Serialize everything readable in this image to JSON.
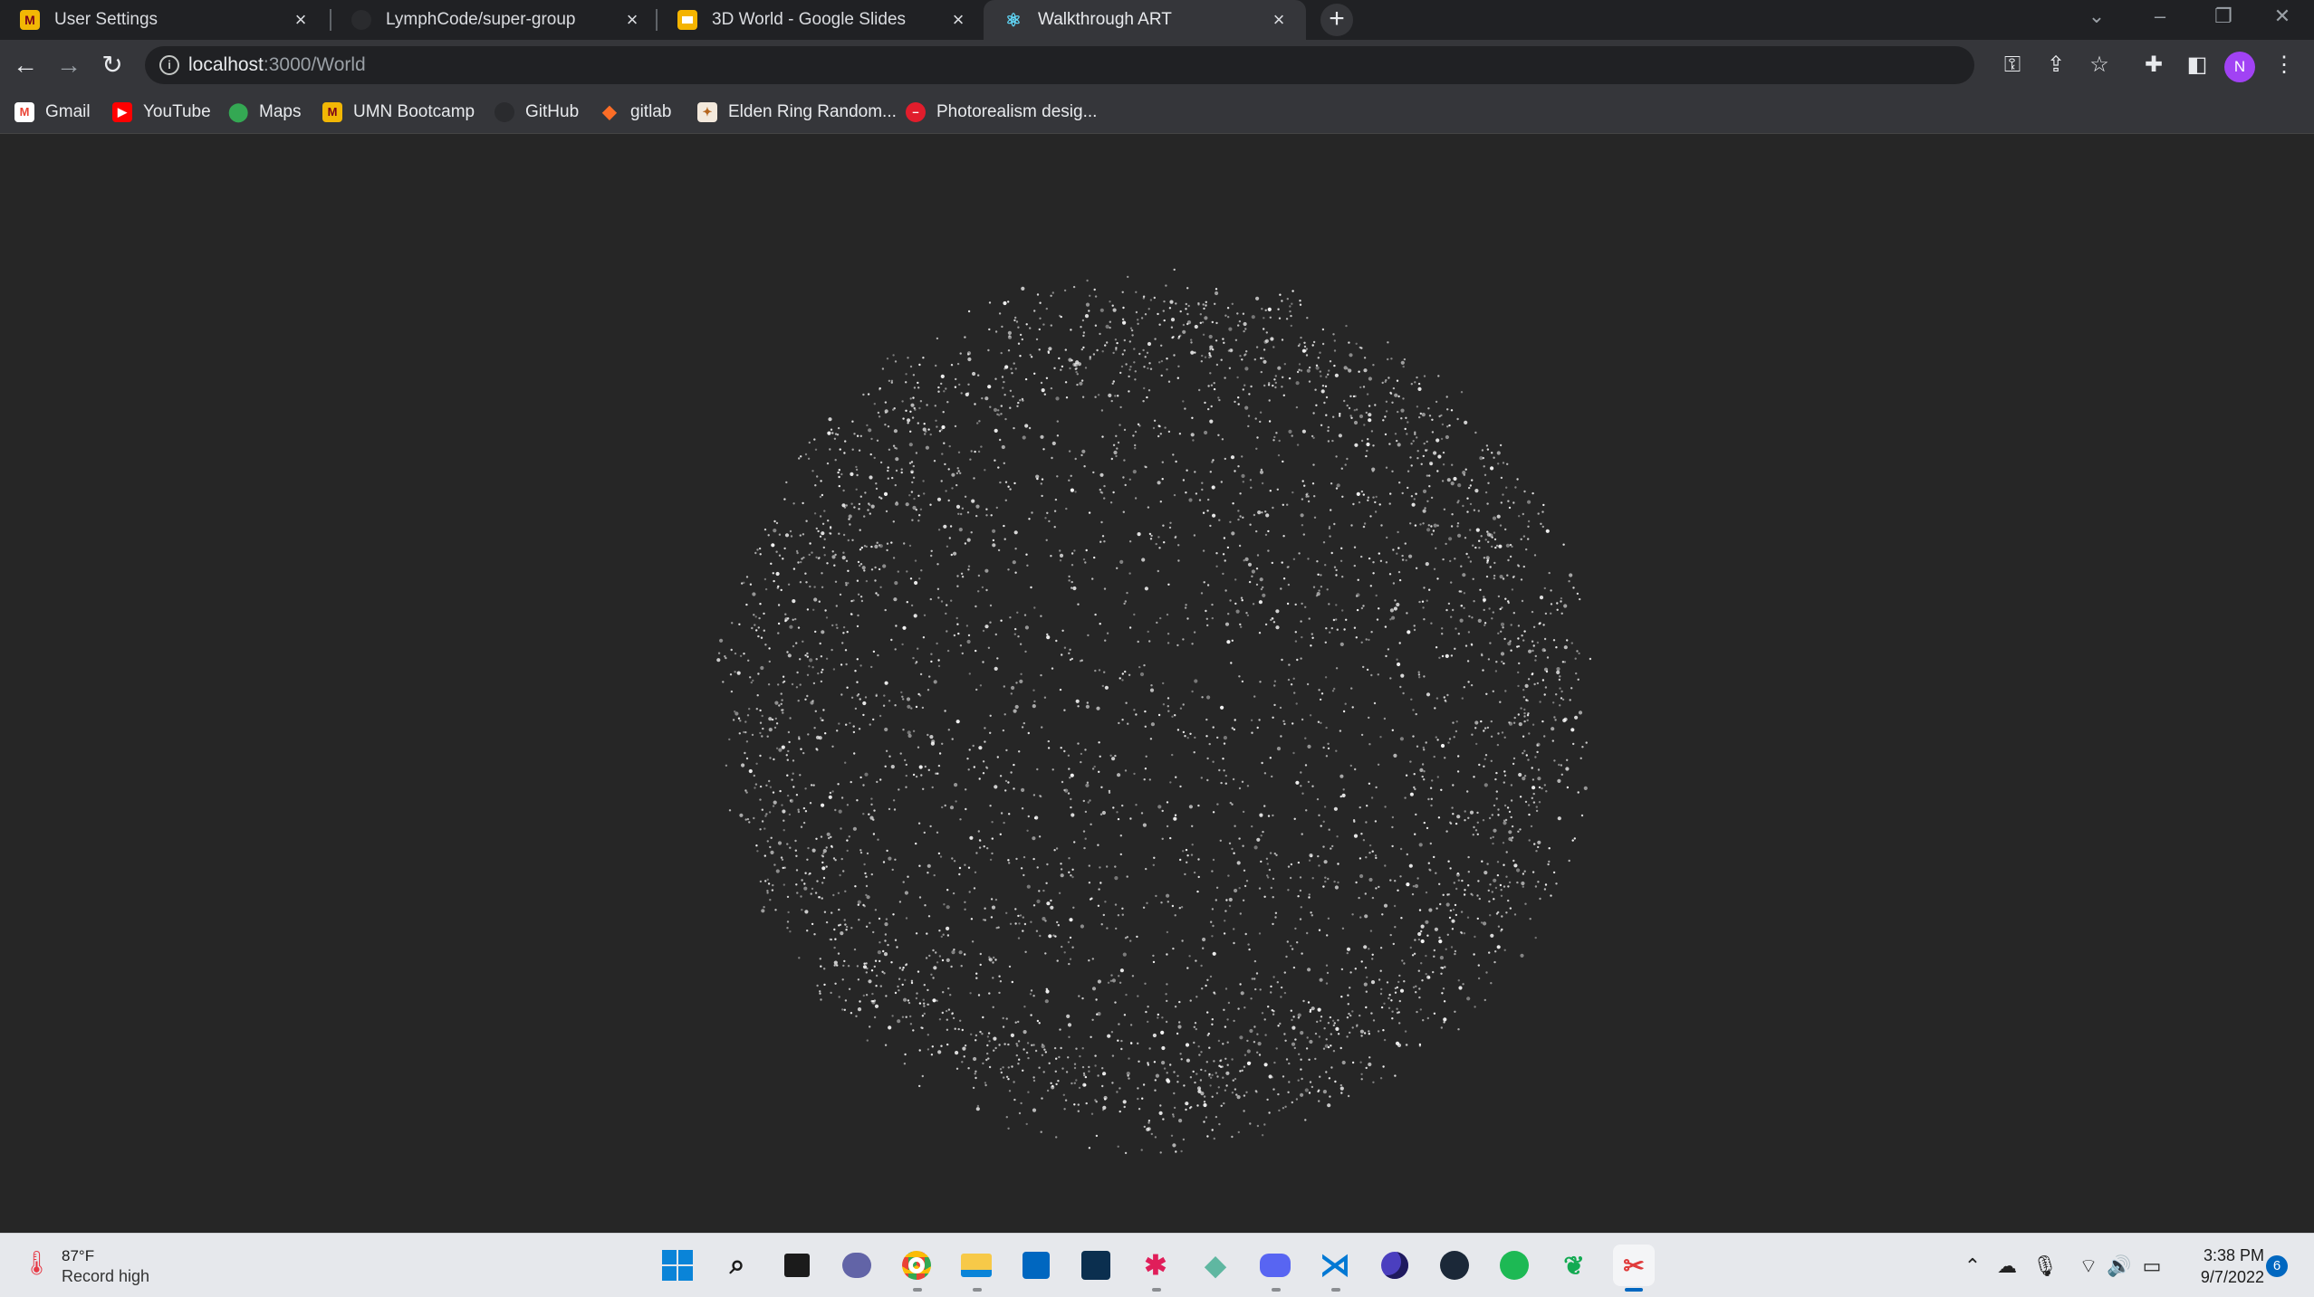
{
  "browser": {
    "tabs": [
      {
        "title": "User Settings",
        "icon": "umn-logo-icon",
        "active": false
      },
      {
        "title": "LymphCode/super-group",
        "icon": "github-icon",
        "active": false
      },
      {
        "title": "3D World - Google Slides",
        "icon": "google-slides-icon",
        "active": false
      },
      {
        "title": "Walkthrough ART",
        "icon": "react-icon",
        "active": true
      }
    ],
    "new_tab_label": "+",
    "address": {
      "host": "localhost",
      "path": ":3000/World"
    },
    "profile_initial": "N"
  },
  "bookmarks": [
    {
      "label": "Gmail",
      "icon": "gmail-icon"
    },
    {
      "label": "YouTube",
      "icon": "youtube-icon"
    },
    {
      "label": "Maps",
      "icon": "maps-icon"
    },
    {
      "label": "UMN Bootcamp",
      "icon": "umn-logo-icon"
    },
    {
      "label": "GitHub",
      "icon": "github-icon"
    },
    {
      "label": "gitlab",
      "icon": "gitlab-icon"
    },
    {
      "label": "Elden Ring Random...",
      "icon": "elden-ring-icon"
    },
    {
      "label": "Photorealism desig...",
      "icon": "photorealism-icon"
    }
  ],
  "scene": {
    "description_icon": "particle-sphere",
    "background_color": "#262626",
    "particle_color": "#ffffff"
  },
  "taskbar": {
    "weather": {
      "temperature": "87°F",
      "condition": "Record high"
    },
    "apps": [
      "windows-start-icon",
      "search-icon",
      "task-view-icon",
      "teams-chat-icon",
      "chrome-icon",
      "file-explorer-icon",
      "microsoft-store-icon",
      "unknown-app-icon",
      "slack-icon",
      "gitkraken-icon",
      "discord-icon",
      "vscode-icon",
      "unknown-moon-icon",
      "steam-icon",
      "spotify-icon",
      "mongodb-compass-icon",
      "snipping-tool-icon"
    ],
    "clock": {
      "time": "3:38 PM",
      "date": "9/7/2022"
    },
    "notification_count": "6"
  }
}
